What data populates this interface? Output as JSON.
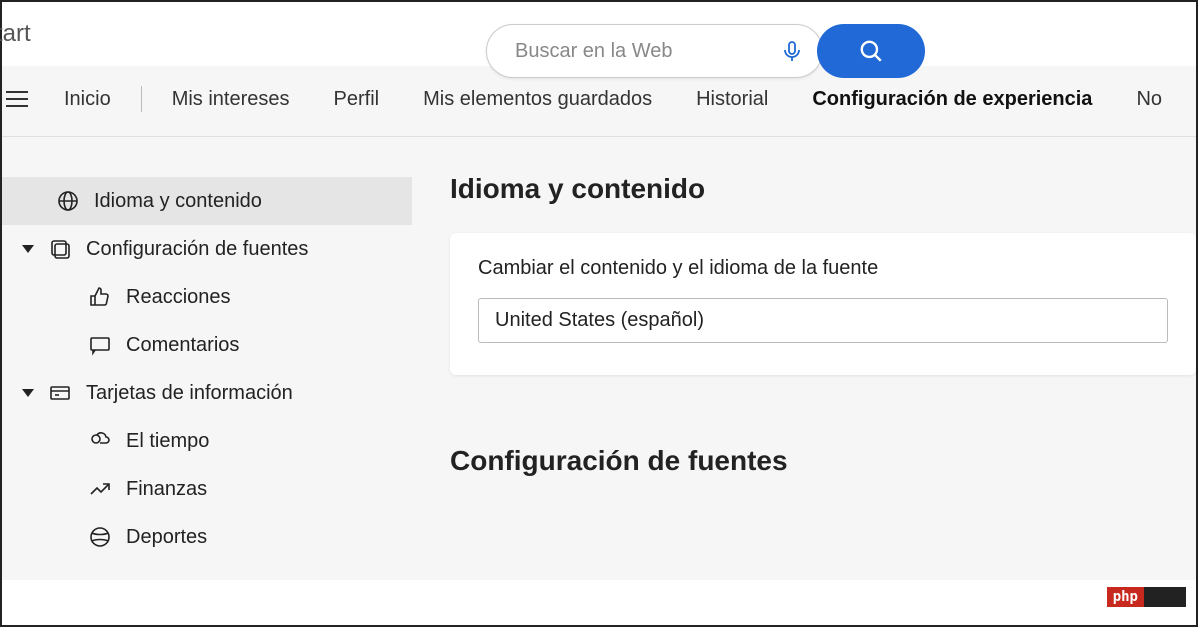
{
  "header": {
    "logo_text": "tart",
    "search_placeholder": "Buscar en la Web"
  },
  "nav": {
    "items": [
      "Inicio",
      "Mis intereses",
      "Perfil",
      "Mis elementos guardados",
      "Historial",
      "Configuración de experiencia",
      "No"
    ]
  },
  "sidebar": {
    "items": [
      {
        "label": "Idioma y contenido",
        "icon": "globe",
        "selected": true,
        "level": "top"
      },
      {
        "label": "Configuración de fuentes",
        "icon": "sources",
        "level": "parent"
      },
      {
        "label": "Reacciones",
        "icon": "thumbs-up",
        "level": "child"
      },
      {
        "label": "Comentarios",
        "icon": "comment",
        "level": "child"
      },
      {
        "label": "Tarjetas de información",
        "icon": "cards",
        "level": "parent"
      },
      {
        "label": "El tiempo",
        "icon": "weather",
        "level": "child"
      },
      {
        "label": "Finanzas",
        "icon": "finance",
        "level": "child"
      },
      {
        "label": "Deportes",
        "icon": "sports",
        "level": "child"
      }
    ]
  },
  "content": {
    "section1_title": "Idioma y contenido",
    "section1_label": "Cambiar el contenido y el idioma de la fuente",
    "section1_value": "United States (español)",
    "section2_title": "Configuración de fuentes"
  },
  "badge": {
    "text": "php"
  }
}
